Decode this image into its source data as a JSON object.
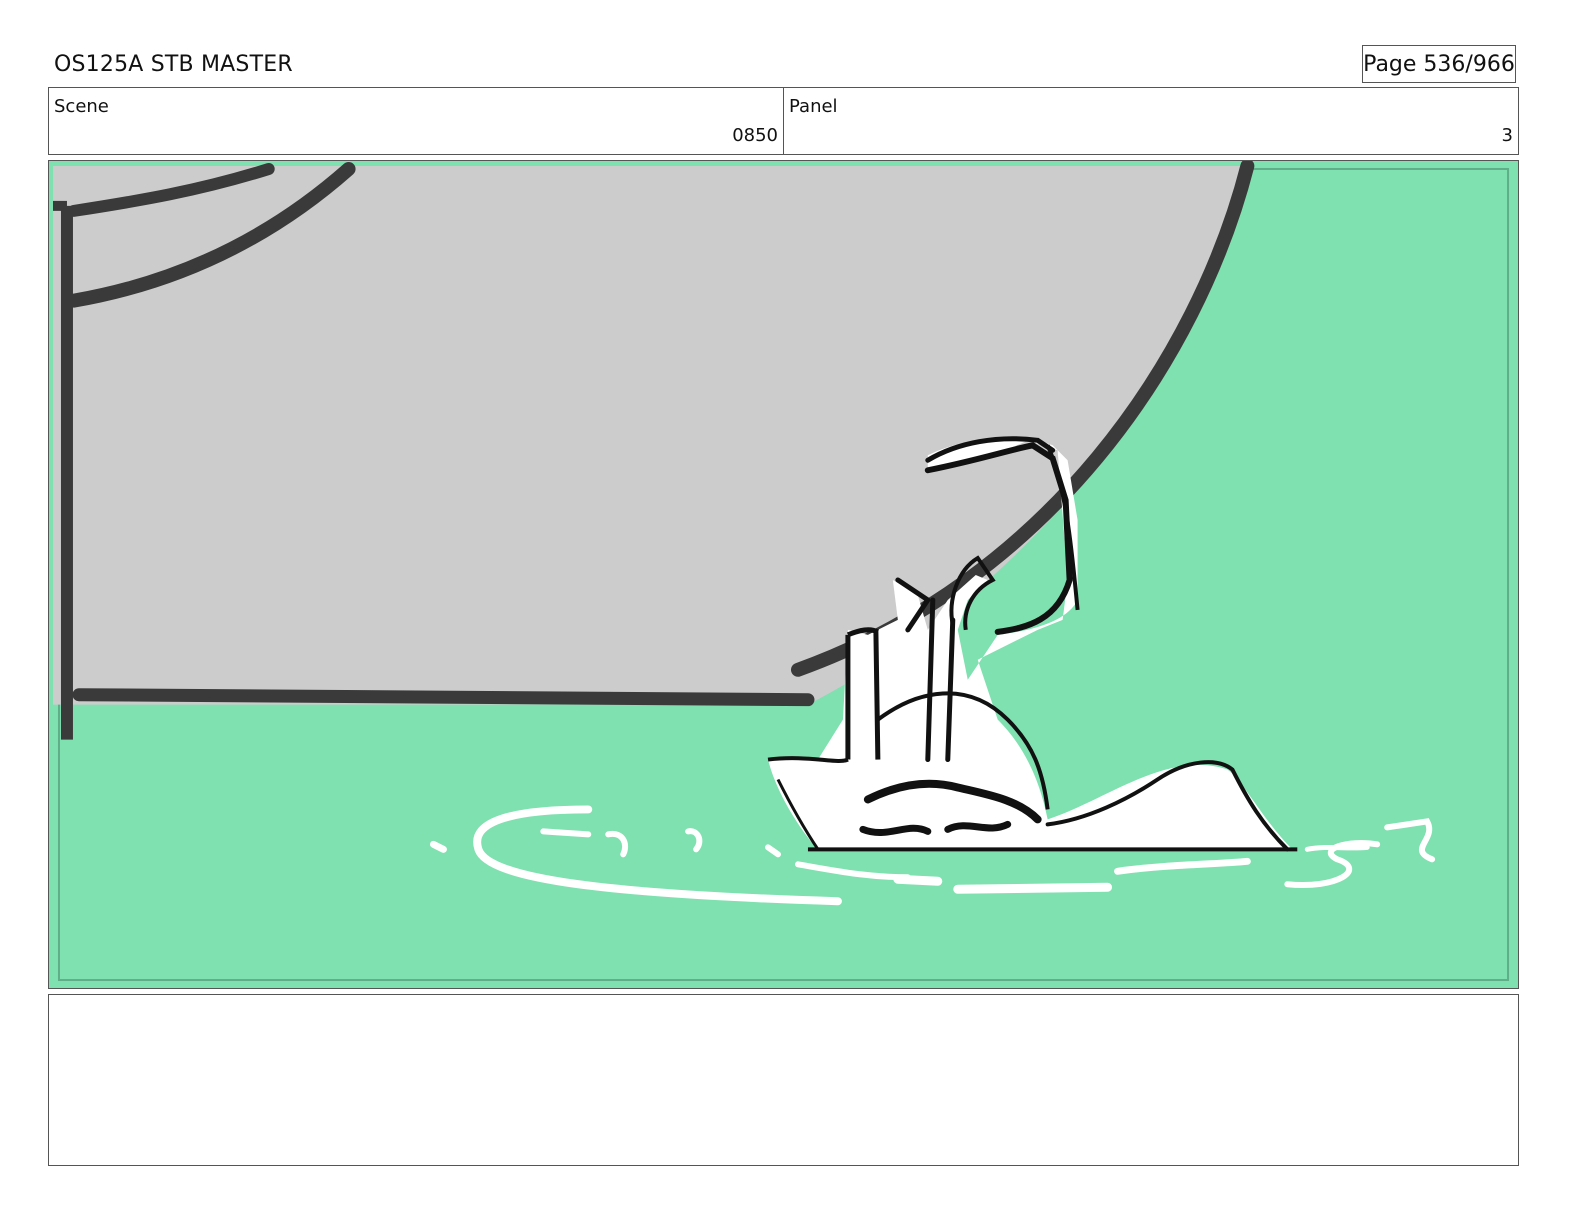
{
  "header": {
    "title": "OS125A STB MASTER",
    "page": "Page 536/966"
  },
  "info": {
    "scene_label": "Scene",
    "scene_value": "0850",
    "panel_label": "Panel",
    "panel_value": "3"
  },
  "panel_art": {
    "background_color": "#7fe0b0",
    "wall_color": "#cccccc",
    "stroke_color": "#333333"
  },
  "notes": {
    "text": ""
  }
}
